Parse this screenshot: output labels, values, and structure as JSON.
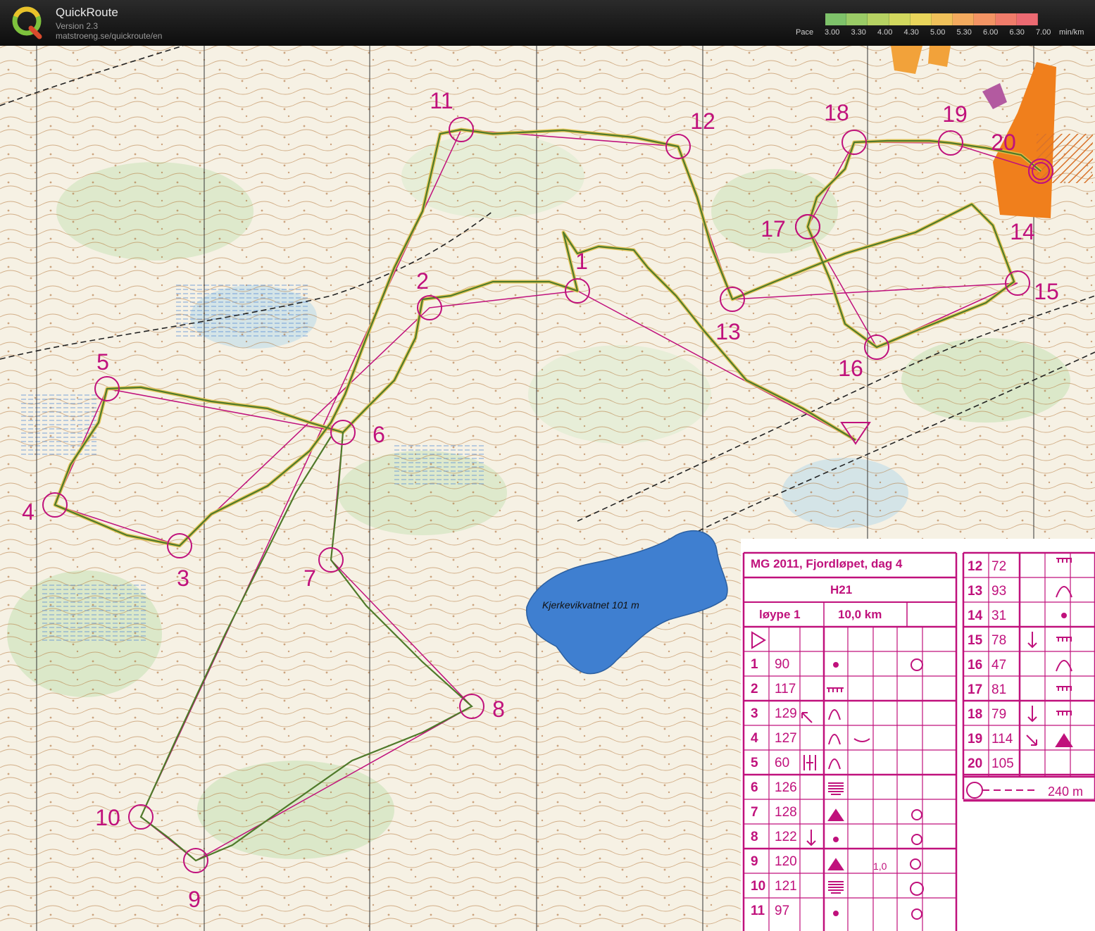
{
  "app": {
    "name": "QuickRoute",
    "version": "Version 2.3",
    "url": "matstroeng.se/quickroute/en",
    "logo_letter": "Q"
  },
  "pace_legend": {
    "prefix": "Pace",
    "ticks": [
      "3.00",
      "3.30",
      "4.00",
      "4.30",
      "5.00",
      "5.30",
      "6.00",
      "6.30",
      "7.00"
    ],
    "unit": "min/km",
    "colors": [
      "#7ec26a",
      "#9acb66",
      "#b6d262",
      "#d2d85e",
      "#e9d55b",
      "#f0c15a",
      "#f3aa5e",
      "#f39464",
      "#f07c6a",
      "#ec6a72"
    ]
  },
  "map": {
    "lake_name": "Kjerkevikvatnet 101 m",
    "control_labels": [
      "1",
      "2",
      "3",
      "4",
      "5",
      "6",
      "7",
      "8",
      "9",
      "10",
      "11",
      "12",
      "13",
      "14",
      "15",
      "16",
      "17",
      "18",
      "19",
      "20"
    ],
    "course_color": "#c0117c",
    "route_color": "#4f7a2a",
    "water_color": "#3f7fd0"
  },
  "control_descriptions": {
    "title": "MG 2011, Fjordløpet, dag 4",
    "class": "H21",
    "course": "løype 1",
    "length": "10,0 km",
    "left_rows": [
      {
        "no": "1",
        "code": "90"
      },
      {
        "no": "2",
        "code": "117"
      },
      {
        "no": "3",
        "code": "129"
      },
      {
        "no": "4",
        "code": "127"
      },
      {
        "no": "5",
        "code": "60"
      },
      {
        "no": "6",
        "code": "126"
      },
      {
        "no": "7",
        "code": "128"
      },
      {
        "no": "8",
        "code": "122"
      },
      {
        "no": "9",
        "code": "120"
      },
      {
        "no": "10",
        "code": "121"
      },
      {
        "no": "11",
        "code": "97"
      }
    ],
    "right_rows": [
      {
        "no": "12",
        "code": "72"
      },
      {
        "no": "13",
        "code": "93"
      },
      {
        "no": "14",
        "code": "31"
      },
      {
        "no": "15",
        "code": "78"
      },
      {
        "no": "16",
        "code": "47"
      },
      {
        "no": "17",
        "code": "81"
      },
      {
        "no": "18",
        "code": "79"
      },
      {
        "no": "19",
        "code": "114"
      },
      {
        "no": "20",
        "code": "105"
      }
    ],
    "dimension_9": "1,0",
    "finish_distance": "240 m"
  }
}
